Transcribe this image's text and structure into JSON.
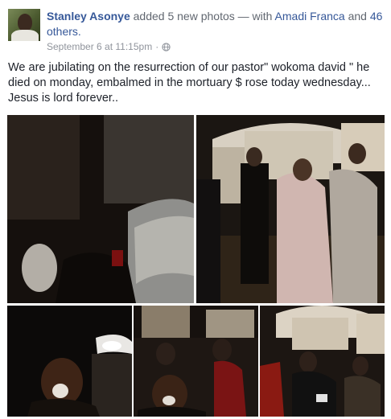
{
  "post": {
    "author": "Stanley Asonye",
    "action_text": "added 5 new photos — with",
    "tagged_name": "Amadi Franca",
    "and_text": "and",
    "others_text": "46 others.",
    "timestamp": "September 6 at 11:15pm",
    "separator": "·",
    "privacy_icon": "globe-icon",
    "body": "We are jubilating on the resurrection of our pastor\" wokoma david \" he died on monday, embalmed in the mortuary $ rose today wednesday... Jesus is lord forever..",
    "photos_count": 5
  },
  "colors": {
    "link": "#365899",
    "meta": "#90949c",
    "text": "#1d2129"
  }
}
